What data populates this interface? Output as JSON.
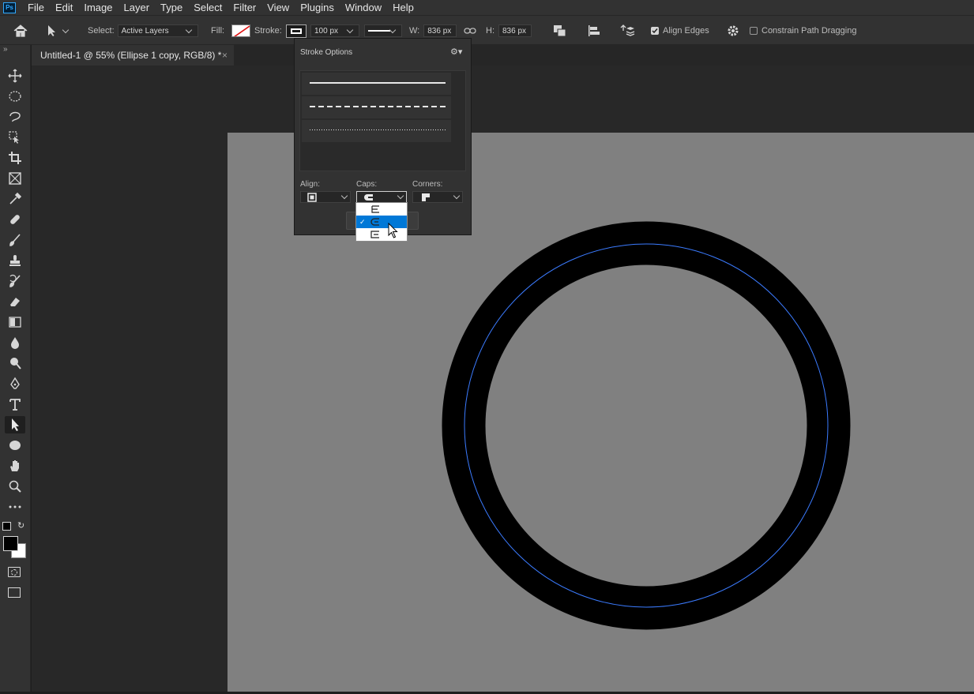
{
  "app": {
    "logo": "Ps"
  },
  "menu": [
    "File",
    "Edit",
    "Image",
    "Layer",
    "Type",
    "Select",
    "Filter",
    "View",
    "Plugins",
    "Window",
    "Help"
  ],
  "options": {
    "select_label": "Select:",
    "select_value": "Active Layers",
    "fill_label": "Fill:",
    "stroke_label": "Stroke:",
    "stroke_width": "100 px",
    "w_label": "W:",
    "w_value": "836 px",
    "h_label": "H:",
    "h_value": "836 px",
    "align_edges": "Align Edges",
    "align_edges_checked": true,
    "constrain": "Constrain Path Dragging",
    "constrain_checked": false
  },
  "document_tab": {
    "title": "Untitled-1 @ 55% (Ellipse 1 copy, RGB/8) *",
    "close": "×"
  },
  "stroke_panel": {
    "title": "Stroke Options",
    "presets": [
      "solid-line",
      "dashed-line",
      "dotted-line"
    ],
    "align_label": "Align:",
    "caps_label": "Caps:",
    "corners_label": "Corners:",
    "caps_options": [
      "butt-cap-icon",
      "round-cap-icon",
      "square-cap-icon"
    ],
    "caps_selected_index": 1
  },
  "colors": {
    "accent": "#0078d7",
    "path_outline": "#3b7bff",
    "stroke_color": "#000000",
    "canvas_fill": "#808080"
  },
  "tools": [
    "move-tool-icon",
    "marquee-tool-icon",
    "lasso-tool-icon",
    "object-select-tool-icon",
    "crop-tool-icon",
    "frame-tool-icon",
    "eyedropper-tool-icon",
    "healing-brush-icon",
    "brush-tool-icon",
    "clone-stamp-icon",
    "history-brush-icon",
    "eraser-tool-icon",
    "gradient-tool-icon",
    "blur-tool-icon",
    "dodge-tool-icon",
    "pen-tool-icon",
    "type-tool-icon",
    "path-selection-tool-icon",
    "ellipse-tool-icon",
    "hand-tool-icon",
    "zoom-tool-icon",
    "more-tools-icon"
  ]
}
